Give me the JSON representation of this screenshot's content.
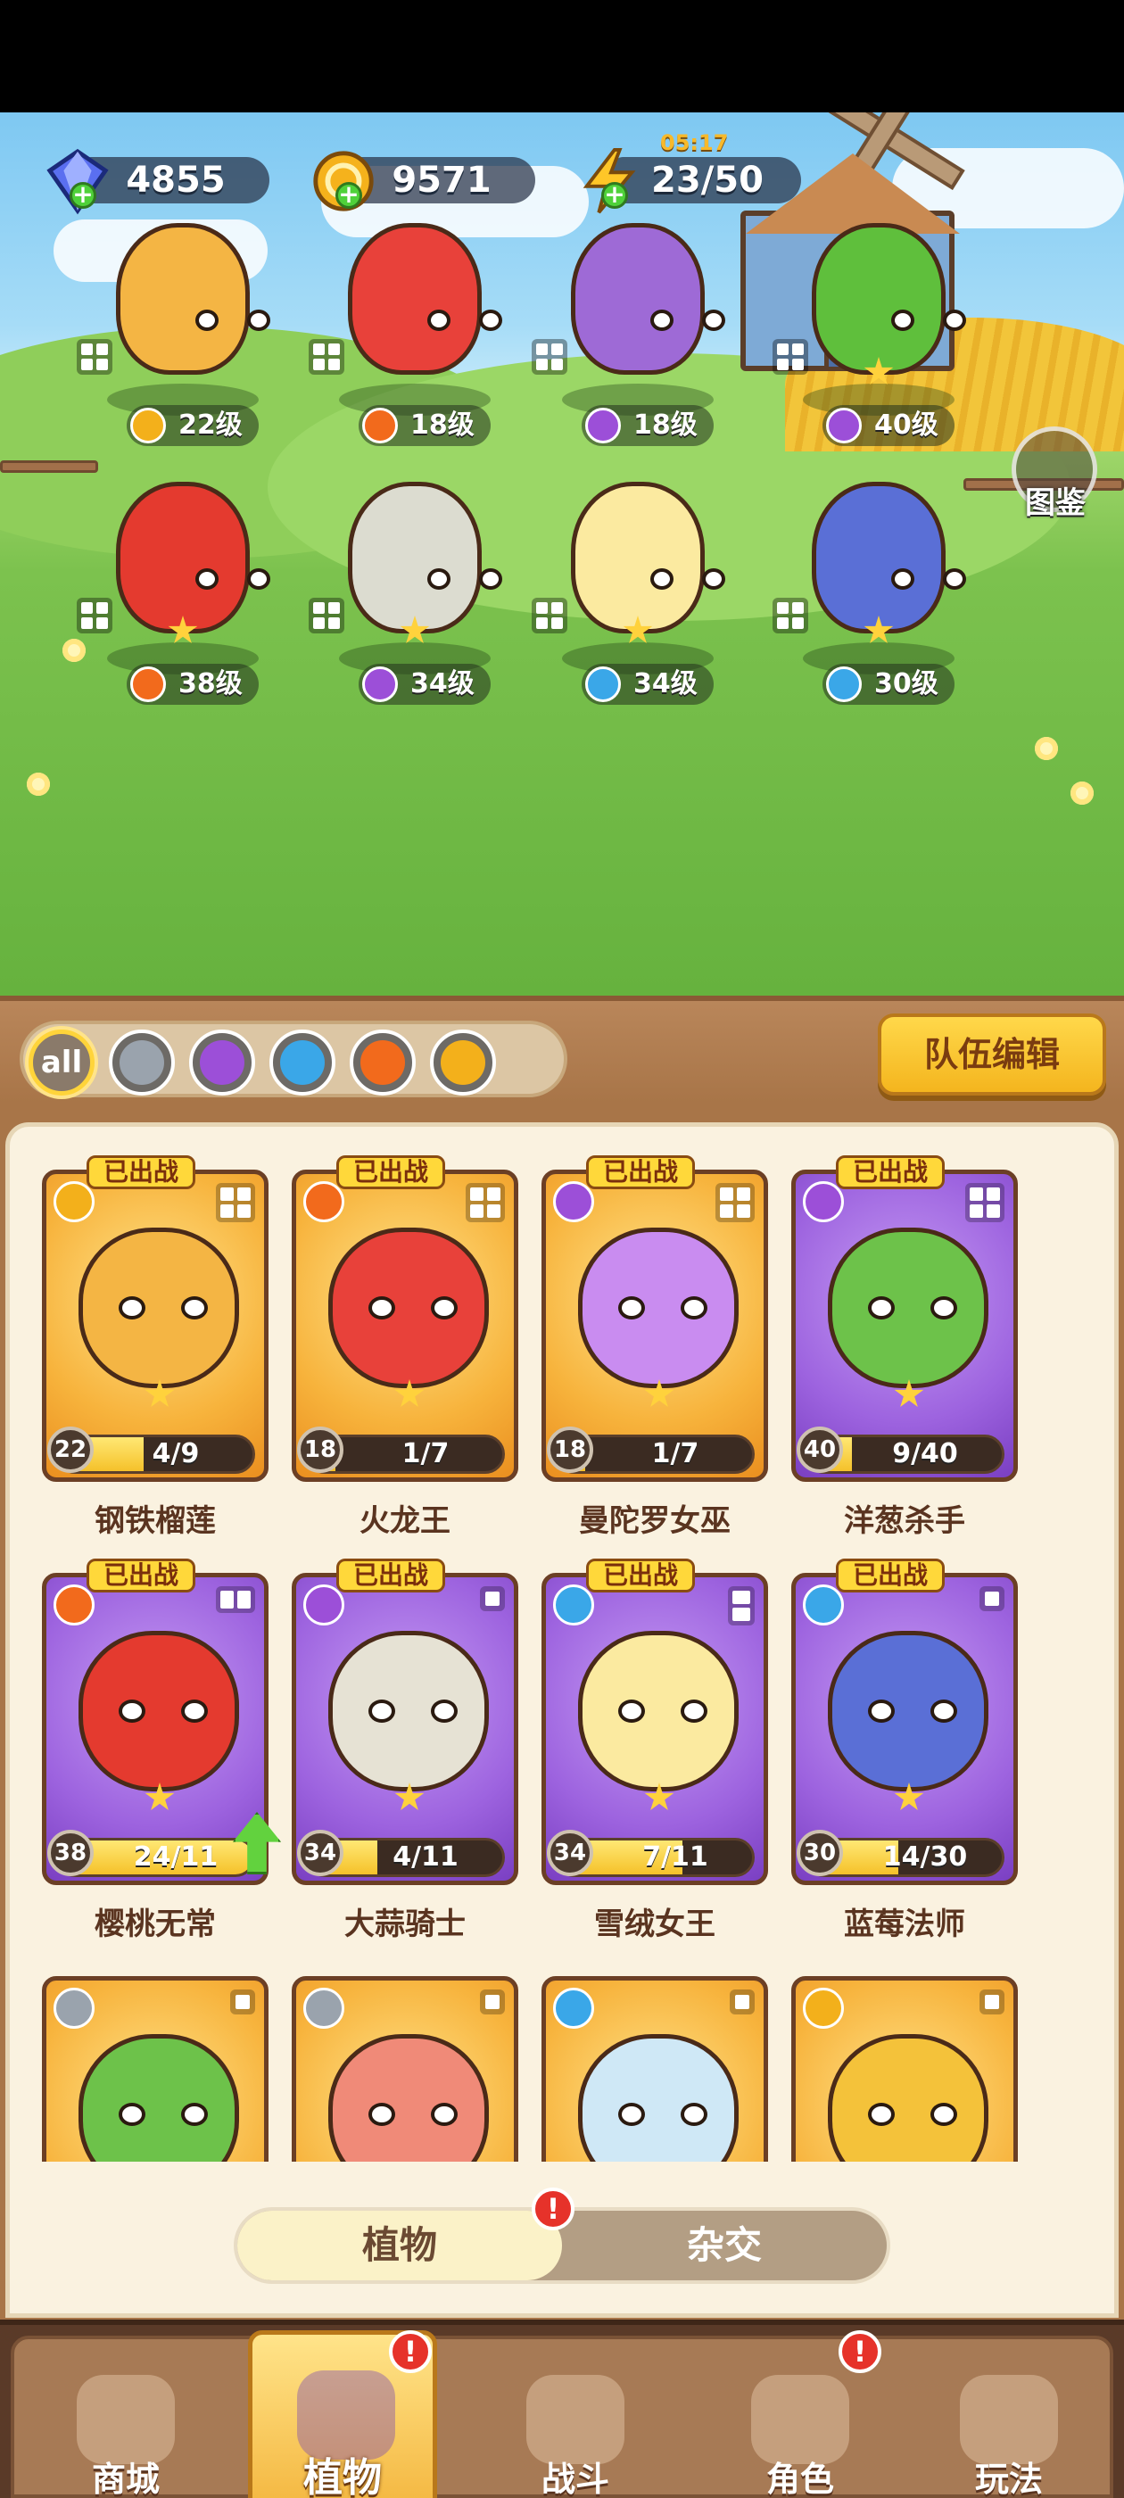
{
  "resources": {
    "gems": "4855",
    "coins": "9571",
    "energy": "23/50",
    "energy_timer": "05:17"
  },
  "atlas_label": "图鉴",
  "field_team": [
    {
      "level": "22级",
      "element": "lightning"
    },
    {
      "level": "18级",
      "element": "fire"
    },
    {
      "level": "18级",
      "element": "poison"
    },
    {
      "level": "40级",
      "element": "poison"
    },
    {
      "level": "38级",
      "element": "fire"
    },
    {
      "level": "34级",
      "element": "poison"
    },
    {
      "level": "34级",
      "element": "water"
    },
    {
      "level": "30级",
      "element": "water"
    }
  ],
  "filters": {
    "all_label": "all",
    "items": [
      "all",
      "sword",
      "poison",
      "water",
      "fire",
      "lightning"
    ]
  },
  "team_edit_label": "队伍编辑",
  "cards": [
    {
      "name": "钢铁榴莲",
      "level": "22",
      "fragments": "4/9",
      "progress": 0.44,
      "tag": "已出战",
      "element": "lightning"
    },
    {
      "name": "火龙王",
      "level": "18",
      "fragments": "1/7",
      "progress": 0.14,
      "tag": "已出战",
      "element": "fire"
    },
    {
      "name": "曼陀罗女巫",
      "level": "18",
      "fragments": "1/7",
      "progress": 0.14,
      "tag": "已出战",
      "element": "poison"
    },
    {
      "name": "洋葱杀手",
      "level": "40",
      "fragments": "9/40",
      "progress": 0.23,
      "tag": "已出战",
      "element": "poison"
    },
    {
      "name": "樱桃无常",
      "level": "38",
      "fragments": "24/11",
      "progress": 1.0,
      "tag": "已出战",
      "element": "fire"
    },
    {
      "name": "大蒜骑士",
      "level": "34",
      "fragments": "4/11",
      "progress": 0.36,
      "tag": "已出战",
      "element": "poison"
    },
    {
      "name": "雪绒女王",
      "level": "34",
      "fragments": "7/11",
      "progress": 0.64,
      "tag": "已出战",
      "element": "water"
    },
    {
      "name": "蓝莓法师",
      "level": "30",
      "fragments": "14/30",
      "progress": 0.47,
      "tag": "已出战",
      "element": "water"
    }
  ],
  "tabs": {
    "plants": "植物",
    "hybrid": "杂交",
    "badge": "!"
  },
  "nav": {
    "shop": "商城",
    "plants": "植物",
    "battle": "战斗",
    "role": "角色",
    "play": "玩法",
    "badge": "!"
  },
  "colors": {
    "lightning": "#f3b01b",
    "fire": "#f26a1c",
    "poison": "#9c4fd8",
    "water": "#3aa7e8",
    "sword": "#9aa3ad"
  }
}
